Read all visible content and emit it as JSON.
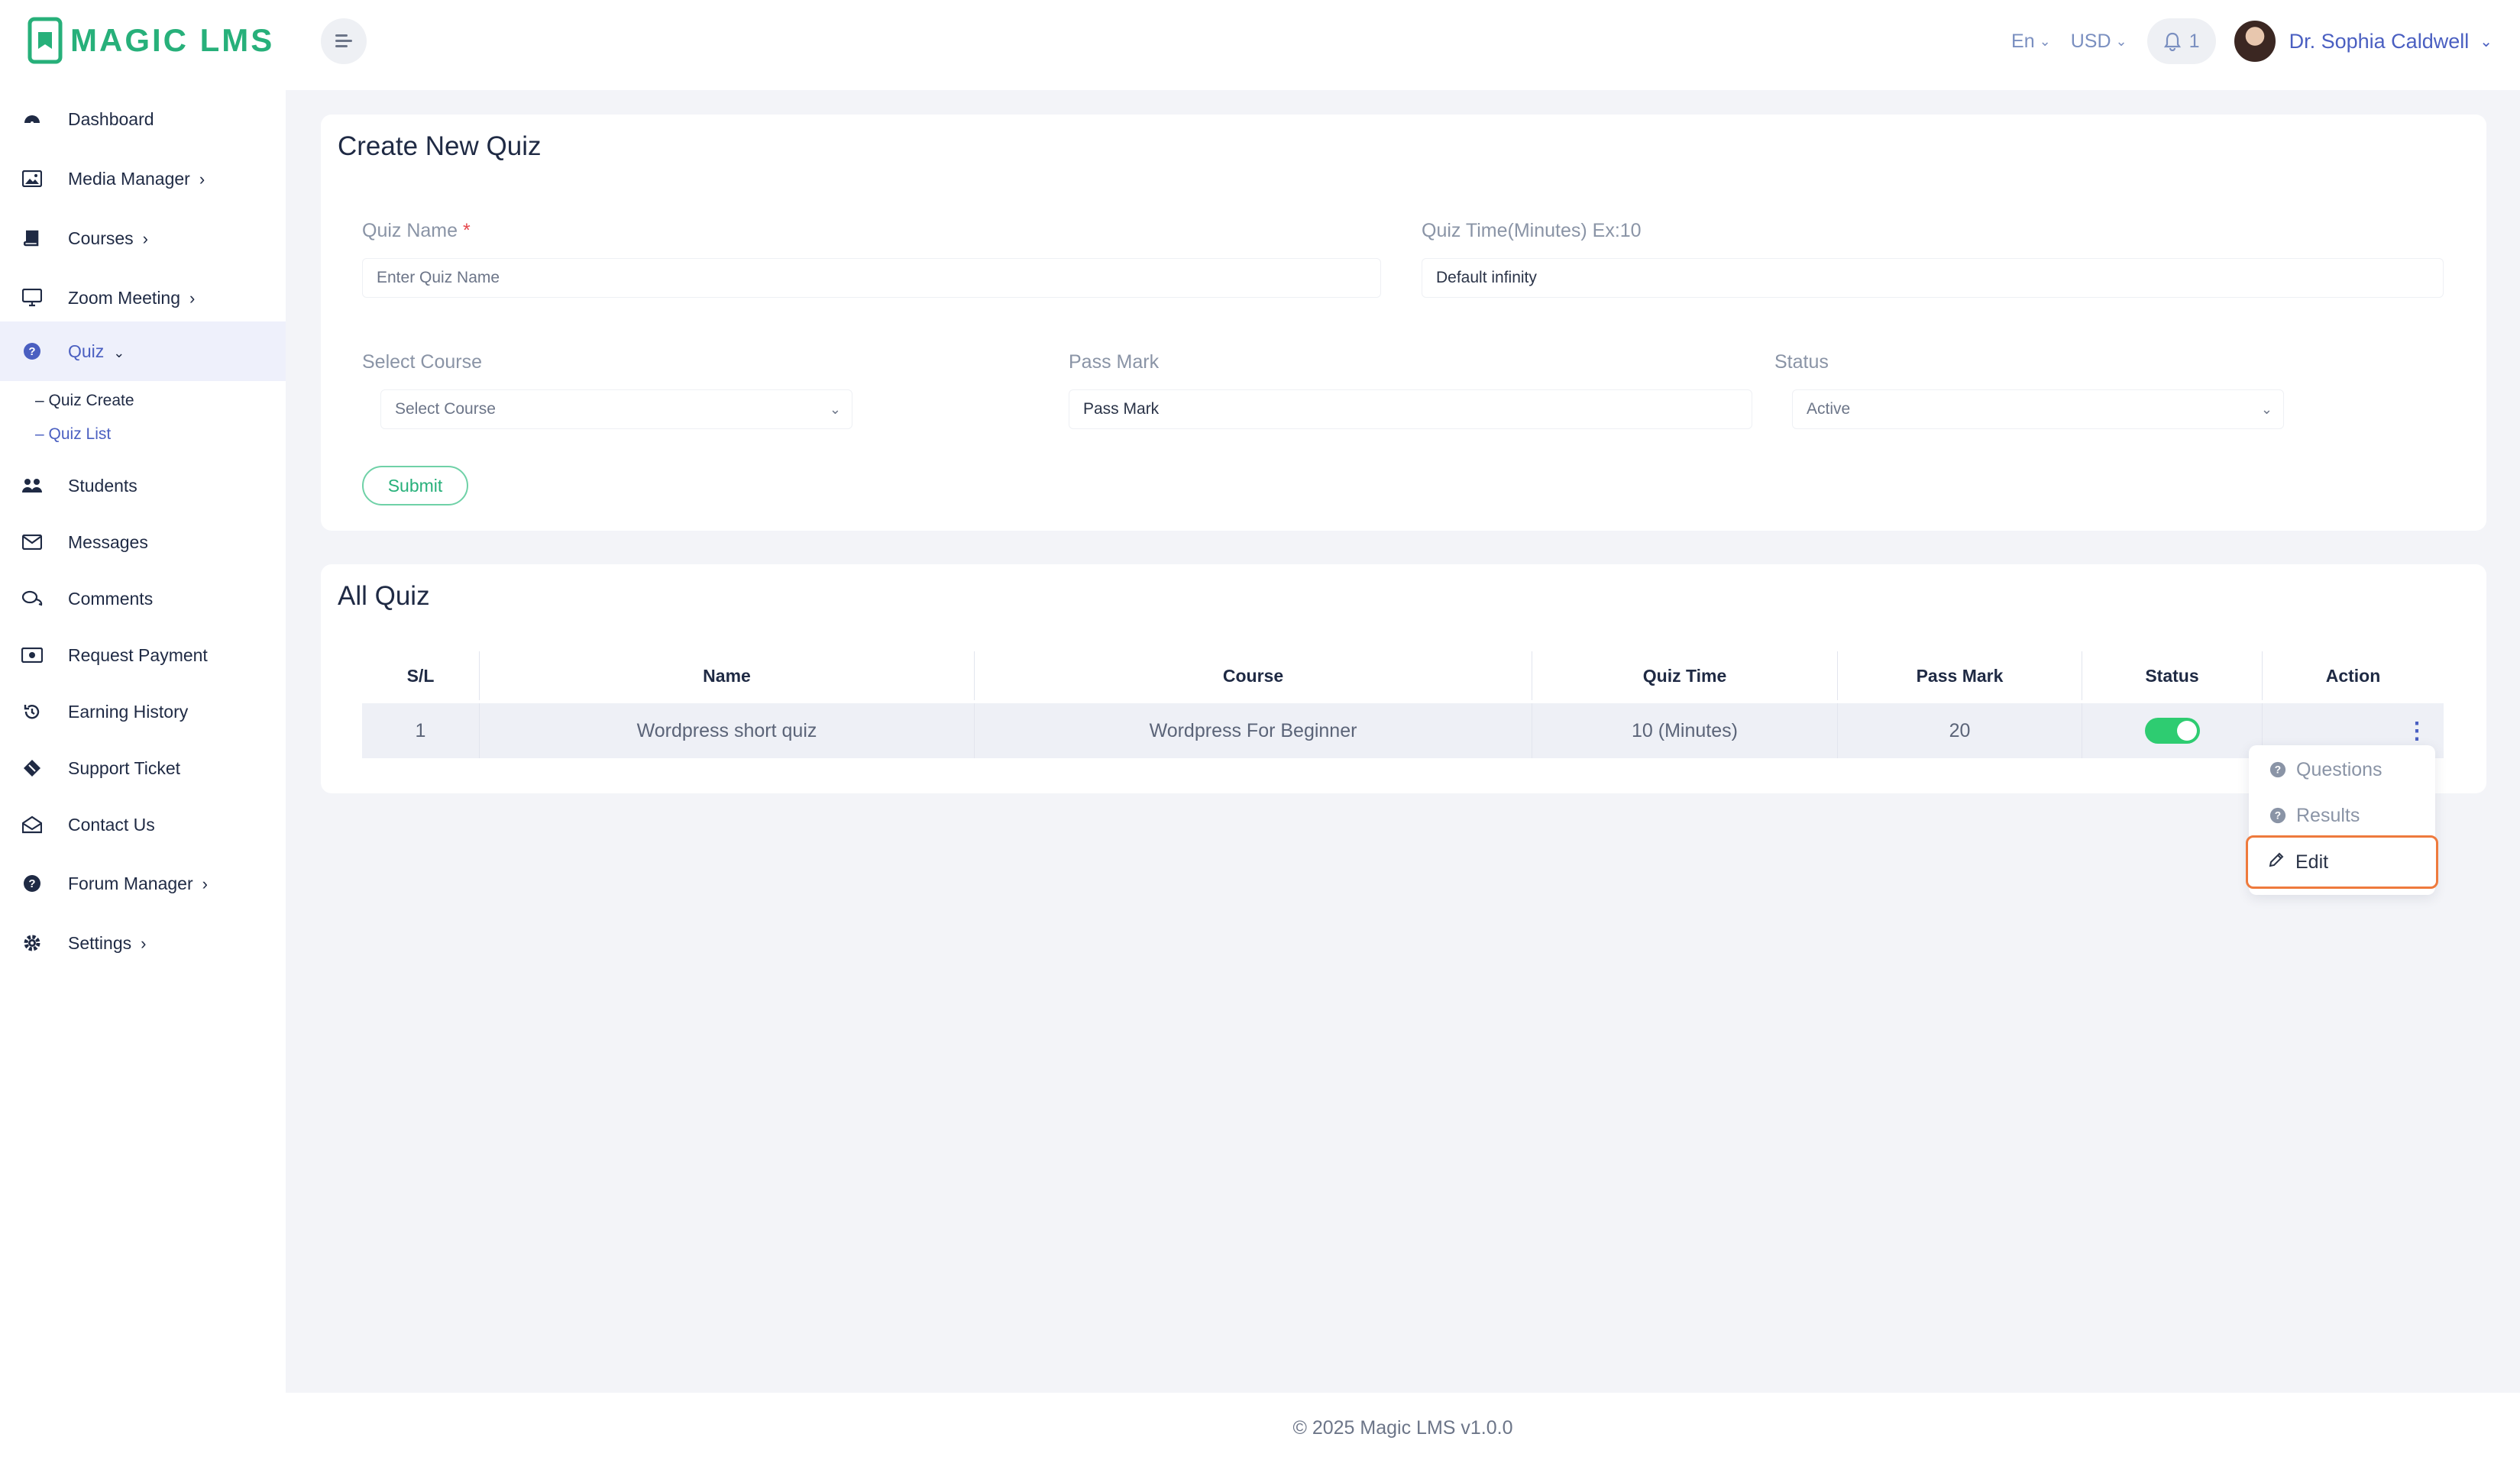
{
  "app": {
    "logo_text": "MAGIC LMS",
    "brand_color": "#27b07a",
    "accent_color": "#4a5fc1"
  },
  "header": {
    "language": "En",
    "currency": "USD",
    "notification_count": "1",
    "user_name": "Dr. Sophia Caldwell"
  },
  "sidebar": {
    "items": [
      {
        "label": "Dashboard",
        "icon": "dashboard-icon"
      },
      {
        "label": "Media Manager",
        "icon": "image-icon",
        "has_children": true
      },
      {
        "label": "Courses",
        "icon": "book-icon",
        "has_children": true
      },
      {
        "label": "Zoom Meeting",
        "icon": "monitor-icon",
        "has_children": true
      },
      {
        "label": "Quiz",
        "icon": "question-circle-icon",
        "expanded": true,
        "active": true
      },
      {
        "label": "Students",
        "icon": "users-icon"
      },
      {
        "label": "Messages",
        "icon": "envelope-icon"
      },
      {
        "label": "Comments",
        "icon": "comments-icon"
      },
      {
        "label": "Request Payment",
        "icon": "money-bill-icon"
      },
      {
        "label": "Earning History",
        "icon": "history-icon"
      },
      {
        "label": "Support Ticket",
        "icon": "ticket-icon"
      },
      {
        "label": "Contact Us",
        "icon": "envelope-open-icon"
      },
      {
        "label": "Forum Manager",
        "icon": "question-circle-icon",
        "has_children": true
      },
      {
        "label": "Settings",
        "icon": "gear-icon",
        "has_children": true
      }
    ],
    "quiz_sub": [
      {
        "label": "– Quiz Create"
      },
      {
        "label": "– Quiz List",
        "active": true
      }
    ]
  },
  "create_quiz": {
    "title": "Create New Quiz",
    "quiz_name_label": "Quiz Name",
    "required_mark": "*",
    "quiz_name_placeholder": "Enter Quiz Name",
    "quiz_time_label": "Quiz Time(Minutes) Ex:10",
    "quiz_time_value": "Default infinity",
    "select_course_label": "Select Course",
    "select_course_value": "Select Course",
    "pass_mark_label": "Pass Mark",
    "pass_mark_value": "Pass Mark",
    "status_label": "Status",
    "status_value": "Active",
    "submit_label": "Submit"
  },
  "all_quiz": {
    "title": "All Quiz",
    "columns": [
      "S/L",
      "Name",
      "Course",
      "Quiz Time",
      "Pass Mark",
      "Status",
      "Action"
    ],
    "rows": [
      {
        "sl": "1",
        "name": "Wordpress short quiz",
        "course": "Wordpress For Beginner",
        "quiz_time": "10 (Minutes)",
        "pass_mark": "20",
        "status_on": true
      }
    ]
  },
  "action_menu": {
    "questions": "Questions",
    "results": "Results",
    "edit": "Edit",
    "highlight_color": "#ee7a3d"
  },
  "footer": {
    "text": "© 2025 Magic LMS v1.0.0"
  }
}
